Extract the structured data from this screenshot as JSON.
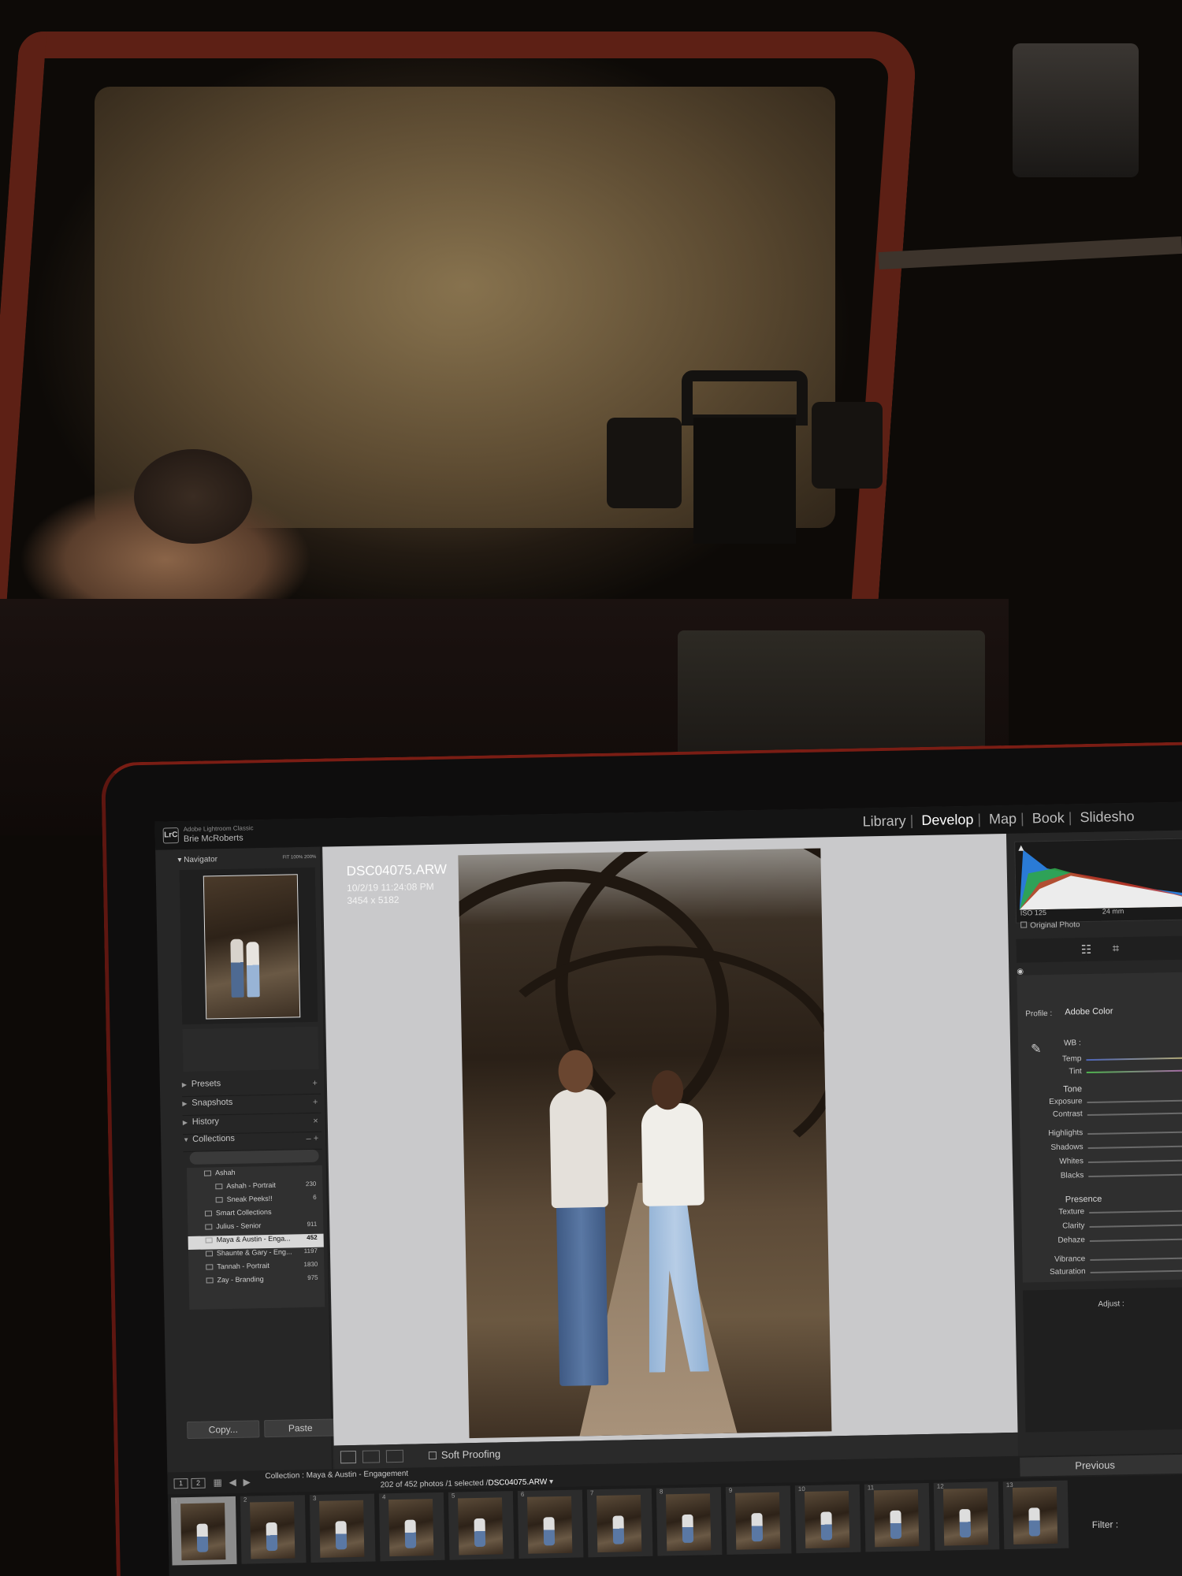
{
  "app": {
    "name": "Adobe Lightroom Classic",
    "user": "Brie McRoberts",
    "badge": "LrC"
  },
  "modules": [
    "Library",
    "Develop",
    "Map",
    "Book",
    "Slidesho"
  ],
  "active_module": "Develop",
  "navigator": {
    "label": "Navigator",
    "zoom_options": "FIT  100%  200%"
  },
  "panels": {
    "presets": "Presets",
    "snapshots": "Snapshots",
    "history": "History",
    "collections": "Collections"
  },
  "collections": [
    {
      "name": "Ashah",
      "count": ""
    },
    {
      "name": "Ashah - Portrait",
      "count": "230"
    },
    {
      "name": "Sneak Peeks!!",
      "count": "6"
    },
    {
      "name": "Smart Collections",
      "count": ""
    },
    {
      "name": "Julius - Senior",
      "count": "911"
    },
    {
      "name": "Maya & Austin - Enga...",
      "count": "452"
    },
    {
      "name": "Shaunte & Gary - Eng...",
      "count": "1197"
    },
    {
      "name": "Tannah - Portrait",
      "count": "1830"
    },
    {
      "name": "Zay - Branding",
      "count": "975"
    }
  ],
  "buttons": {
    "copy": "Copy...",
    "paste": "Paste",
    "previous": "Previous"
  },
  "photo_info": {
    "filename": "DSC04075.ARW",
    "datetime": "10/2/19 11:24:08 PM",
    "dimensions": "3454 x 5182"
  },
  "toolbar": {
    "soft_proofing": "Soft Proofing"
  },
  "filmstrip": {
    "pages": [
      "1",
      "2"
    ],
    "collection": "Collection : Maya & Austin - Engagement",
    "count": "202 of 452 photos /1 selected /",
    "selected_file": "DSC04075.ARW",
    "filter": "Filter :",
    "frames": [
      "1",
      "2",
      "3",
      "4",
      "5",
      "6",
      "7",
      "8",
      "9",
      "10",
      "11",
      "12",
      "13"
    ]
  },
  "right_panel": {
    "iso": "ISO 125",
    "focal": "24 mm",
    "original_photo": "Original Photo",
    "profile_label": "Profile :",
    "profile_value": "Adobe Color",
    "wb": "WB :",
    "temp": "Temp",
    "tint": "Tint",
    "tone": "Tone",
    "exposure": "Exposure",
    "contrast": "Contrast",
    "highlights": "Highlights",
    "shadows": "Shadows",
    "whites": "Whites",
    "blacks": "Blacks",
    "presence": "Presence",
    "texture": "Texture",
    "clarity": "Clarity",
    "dehaze": "Dehaze",
    "vibrance": "Vibrance",
    "saturation": "Saturation",
    "adjust": "Adjust :"
  },
  "colors": {
    "accent_red": "#7a1d14",
    "panel_bg": "#262626",
    "canvas_bg": "#c9c9cb"
  }
}
